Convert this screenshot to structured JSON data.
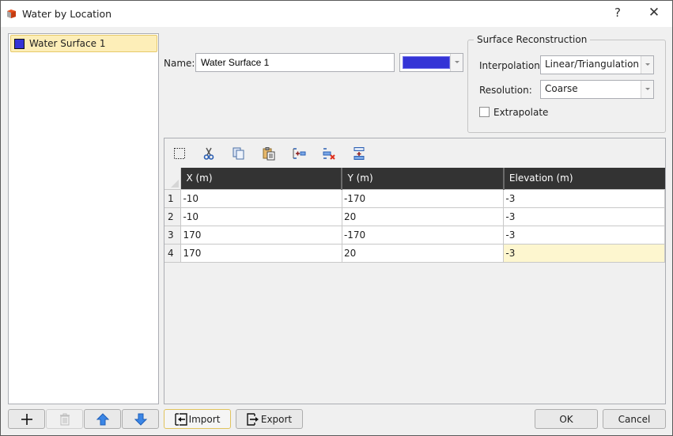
{
  "window": {
    "title": "Water by Location",
    "help_label": "?",
    "close_label": "✕"
  },
  "surfaces": {
    "items": [
      {
        "label": "Water Surface 1",
        "color": "#3434d6",
        "selected": true
      }
    ]
  },
  "properties": {
    "name_label": "Name:",
    "name_value": "Water Surface 1",
    "color": "#3434d6"
  },
  "reconstruction": {
    "group_title": "Surface Reconstruction",
    "interpolation_label": "Interpolation:",
    "interpolation_value": "Linear/Triangulation",
    "resolution_label": "Resolution:",
    "resolution_value": "Coarse",
    "extrapolate_label": "Extrapolate",
    "extrapolate_checked": false
  },
  "toolbar": {
    "icons": [
      "select-all-icon",
      "cut-icon",
      "copy-icon",
      "paste-icon",
      "insert-row-icon",
      "delete-row-icon",
      "append-row-icon"
    ]
  },
  "table": {
    "columns": [
      "X (m)",
      "Y (m)",
      "Elevation (m)"
    ],
    "rows": [
      {
        "num": "1",
        "x": "-10",
        "y": "-170",
        "elev": "-3"
      },
      {
        "num": "2",
        "x": "-10",
        "y": "20",
        "elev": "-3"
      },
      {
        "num": "3",
        "x": "170",
        "y": "-170",
        "elev": "-3"
      },
      {
        "num": "4",
        "x": "170",
        "y": "20",
        "elev": "-3"
      }
    ]
  },
  "buttons": {
    "add": "+",
    "import": "Import",
    "export": "Export",
    "ok": "OK",
    "cancel": "Cancel"
  }
}
